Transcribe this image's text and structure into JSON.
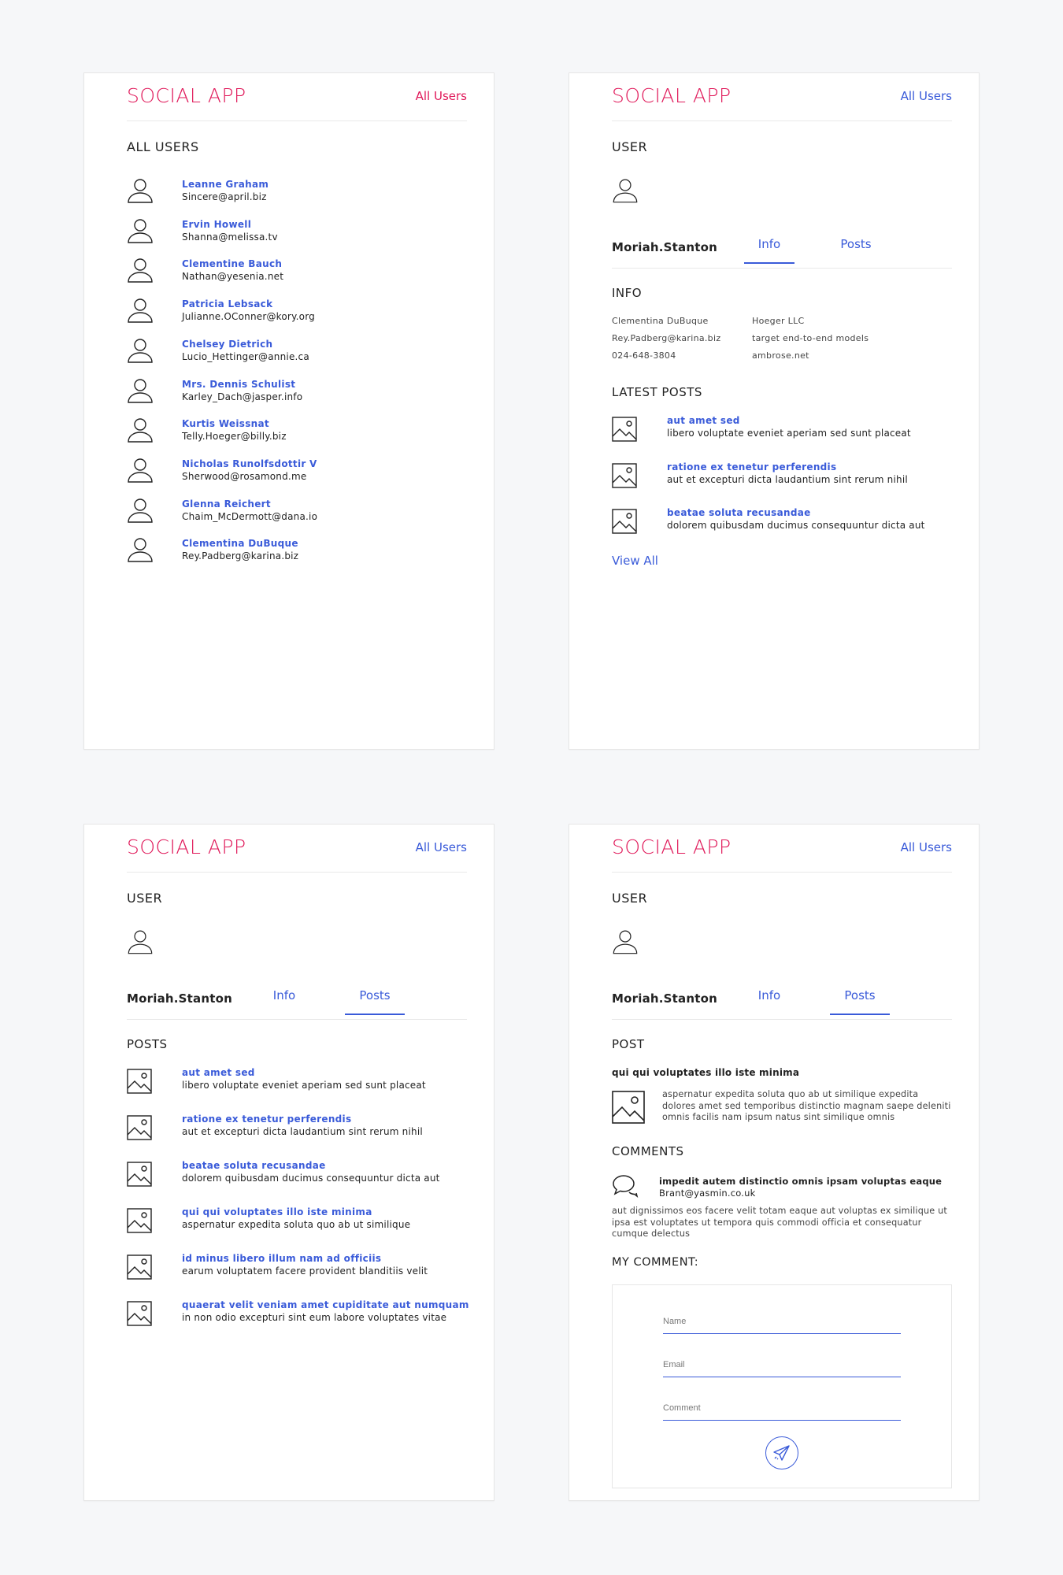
{
  "brand": "SOCIAL APP",
  "nav_all_users": "All Users",
  "colors": {
    "brand": "#e0195a",
    "link": "#3a5bd9",
    "text": "#222222",
    "background": "#f6f7f9"
  },
  "screen1": {
    "title": "ALL USERS",
    "users": [
      {
        "name": "Leanne Graham",
        "email": "Sincere@april.biz"
      },
      {
        "name": "Ervin Howell",
        "email": "Shanna@melissa.tv"
      },
      {
        "name": "Clementine Bauch",
        "email": "Nathan@yesenia.net"
      },
      {
        "name": "Patricia Lebsack",
        "email": "Julianne.OConner@kory.org"
      },
      {
        "name": "Chelsey Dietrich",
        "email": "Lucio_Hettinger@annie.ca"
      },
      {
        "name": "Mrs. Dennis Schulist",
        "email": "Karley_Dach@jasper.info"
      },
      {
        "name": "Kurtis Weissnat",
        "email": "Telly.Hoeger@billy.biz"
      },
      {
        "name": "Nicholas Runolfsdottir V",
        "email": "Sherwood@rosamond.me"
      },
      {
        "name": "Glenna Reichert",
        "email": "Chaim_McDermott@dana.io"
      },
      {
        "name": "Clementina DuBuque",
        "email": "Rey.Padberg@karina.biz"
      }
    ]
  },
  "user_title": "USER",
  "username": "Moriah.Stanton",
  "tabs": {
    "info": "Info",
    "posts": "Posts"
  },
  "screen2": {
    "active_tab": "Info",
    "info_title": "INFO",
    "info_left": [
      "Clementina DuBuque",
      "Rey.Padberg@karina.biz",
      "024-648-3804"
    ],
    "info_right": [
      "Hoeger LLC",
      "target end-to-end models",
      "ambrose.net"
    ],
    "latest_title": "LATEST POSTS",
    "latest_posts": [
      {
        "title": "aut amet sed",
        "body": "libero voluptate eveniet aperiam sed sunt placeat"
      },
      {
        "title": "ratione ex tenetur perferendis",
        "body": "aut et excepturi dicta laudantium sint rerum nihil"
      },
      {
        "title": "beatae soluta recusandae",
        "body": "dolorem quibusdam ducimus consequuntur dicta aut"
      }
    ],
    "view_all": "View All"
  },
  "screen3": {
    "active_tab": "Posts",
    "posts_title": "POSTS",
    "posts": [
      {
        "title": "aut amet sed",
        "body": "libero voluptate eveniet aperiam sed sunt placeat"
      },
      {
        "title": "ratione ex tenetur perferendis",
        "body": "aut et excepturi dicta laudantium sint rerum nihil"
      },
      {
        "title": "beatae soluta recusandae",
        "body": "dolorem quibusdam ducimus consequuntur dicta aut"
      },
      {
        "title": "qui qui voluptates illo iste minima",
        "body": "aspernatur expedita soluta quo ab ut similique"
      },
      {
        "title": "id minus libero illum nam ad officiis",
        "body": "earum voluptatem facere provident blanditiis velit"
      },
      {
        "title": "quaerat velit veniam amet cupiditate aut numquam",
        "body": "in non odio excepturi sint eum labore voluptates vitae"
      }
    ]
  },
  "screen4": {
    "active_tab": "Posts",
    "post_title_label": "POST",
    "post_heading": "qui qui voluptates illo iste minima",
    "post_body": "aspernatur expedita soluta quo ab ut similique expedita dolores amet sed temporibus distinctio magnam saepe deleniti omnis facilis nam ipsum natus sint similique omnis",
    "comments_title": "COMMENTS",
    "comment": {
      "title": "impedit autem distinctio omnis ipsam voluptas eaque",
      "email": "Brant@yasmin.co.uk",
      "body": "aut dignissimos eos facere velit totam eaque aut voluptas ex similique ut ipsa est voluptates ut tempora quis commodi officia et consequatur cumque delectus"
    },
    "my_comment_title": "MY COMMENT:",
    "form": {
      "name_placeholder": "Name",
      "email_placeholder": "Email",
      "comment_placeholder": "Comment"
    }
  },
  "icons": {
    "user": "user-icon",
    "image": "image-icon",
    "comments": "comments-icon",
    "send": "send-icon"
  }
}
